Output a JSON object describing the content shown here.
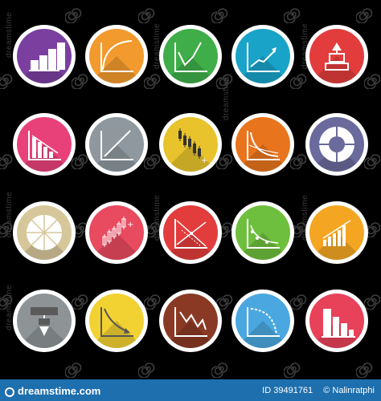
{
  "watermark": {
    "text": "dreamstime"
  },
  "icons": [
    {
      "name": "bar-chart-up-icon",
      "color": "#7b3fa0",
      "glyph": "bars-up"
    },
    {
      "name": "curve-up-icon",
      "color": "#f29a2e",
      "glyph": "curve-up"
    },
    {
      "name": "zigzag-up-icon",
      "color": "#3fae49",
      "glyph": "zigzag-up"
    },
    {
      "name": "trend-up-arrow-icon",
      "color": "#1aa3c8",
      "glyph": "trend-arrow-up"
    },
    {
      "name": "stacked-boxes-icon",
      "color": "#e23c3c",
      "glyph": "stacked-boxes"
    },
    {
      "name": "bar-chart-down-icon",
      "color": "#e8417a",
      "glyph": "bars-down"
    },
    {
      "name": "diagonal-line-icon",
      "color": "#8e989e",
      "glyph": "diagonal"
    },
    {
      "name": "candlestick-down-icon",
      "color": "#e8c32c",
      "glyph": "candles-down"
    },
    {
      "name": "decay-curve-icon",
      "color": "#e8751e",
      "glyph": "decay-curve"
    },
    {
      "name": "donut-chart-icon",
      "color": "#6a6a9c",
      "glyph": "donut"
    },
    {
      "name": "pie-chart-icon",
      "color": "#d6c79a",
      "glyph": "pie"
    },
    {
      "name": "candlestick-up-icon",
      "color": "#e84a5f",
      "glyph": "candles-up"
    },
    {
      "name": "intersecting-lines-icon",
      "color": "#e23c3c",
      "glyph": "intersect"
    },
    {
      "name": "descending-curve-points-icon",
      "color": "#6fbf3e",
      "glyph": "desc-points"
    },
    {
      "name": "bar-chart-growth-icon",
      "color": "#f4a623",
      "glyph": "bars-growth"
    },
    {
      "name": "flow-boxes-down-icon",
      "color": "#8e9396",
      "glyph": "flow-down"
    },
    {
      "name": "curve-down-arrow-icon",
      "color": "#f2d132",
      "glyph": "curve-down-arrow"
    },
    {
      "name": "zigzag-down-icon",
      "color": "#8a3a24",
      "glyph": "zigzag-down"
    },
    {
      "name": "arc-down-icon",
      "color": "#4aa7e0",
      "glyph": "arc-down"
    },
    {
      "name": "bar-chart-decline-icon",
      "color": "#e8415a",
      "glyph": "bars-decline"
    }
  ],
  "footer": {
    "site": "dreamstime.com",
    "id_text": "ID 39491761",
    "author": "Nalinratphi"
  }
}
